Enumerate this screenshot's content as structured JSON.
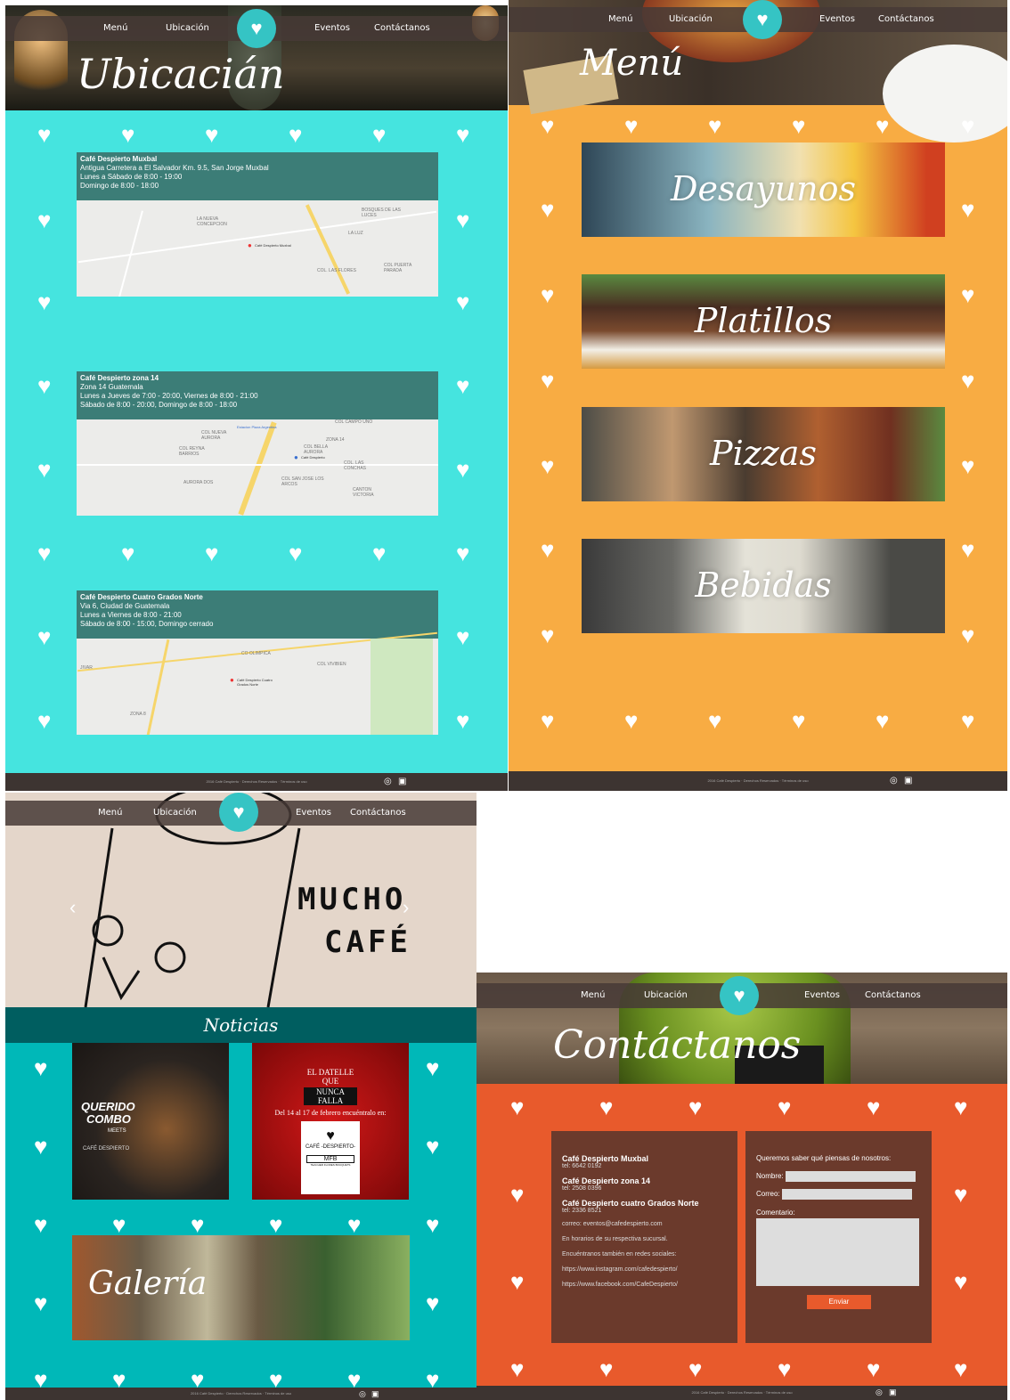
{
  "nav": {
    "menu": "Menú",
    "ubicacion": "Ubicación",
    "eventos": "Eventos",
    "contactanos": "Contáctanos"
  },
  "ubicacion": {
    "title": "Ubicacián",
    "locations": [
      {
        "name": "Café Despierto Muxbal",
        "line1": "Antigua Carretera a El Salvador Km. 9.5, San Jorge Muxbal",
        "line2": "Lunes a Sábado de 8:00 - 19:00",
        "line3": "Domingo de 8:00 - 18:00",
        "pin": "Café Despierto Muxbal",
        "areas": [
          "LA NUEVA CONCEPCION",
          "BOSQUES DE LAS LUCES",
          "LA LUZ",
          "COL. LAS FLORES",
          "COL PUERTA PARADA"
        ]
      },
      {
        "name": "Café Despierto zona 14",
        "line1": "Zona 14 Guatemala",
        "line2": "Lunes a Jueves de 7:00 - 20:00, Viernes de 8:00 - 21:00",
        "line3": "Sábado de 8:00 - 20:00, Domingo de 8:00 - 18:00",
        "pin": "Café Despierto",
        "areas": [
          "COL NUEVA AURORA",
          "COL REYNA BARRIOS",
          "AURORA DOS",
          "ZONA 14",
          "COL BELLA AURORA",
          "COL. LAS CONCHAS",
          "COL SAN JOSE LOS ARCOS",
          "CANTON VICTORIA",
          "COL CAMPO UNO",
          "Estacion Plaza Argentina"
        ]
      },
      {
        "name": "Café Despierto Cuatro Grados Norte",
        "line1": "Via 6, Ciudad de Guatemala",
        "line2": "Lunes a Viernes de 8:00 - 21:00",
        "line3": "Sábado de 8:00 - 15:00, Domingo cerrado",
        "pin": "Café Despierto Cuatro Grados Norte",
        "areas": [
          "CO OLIMPICA",
          "COL VIVIBIEN",
          "ZONA 8",
          "JIVAR"
        ]
      }
    ]
  },
  "menu": {
    "title": "Menú",
    "items": [
      "Desayunos",
      "Platillos",
      "Pizzas",
      "Bebidas"
    ]
  },
  "eventos": {
    "hero_line1": "MUCHO",
    "hero_line2": "CAFÉ",
    "section": "Noticias",
    "gallery": "Galería",
    "news1": {
      "brand1": "QUERIDO",
      "brand2": "COMBO",
      "meets": "MEETS",
      "cafe": "CAFÉ DESPIERTO"
    },
    "news2": {
      "headline1": "EL DATELLE QUE",
      "headline2": "NUNCA FALLA",
      "date": "Del 14 al 17 de febrero encuéntralo en:",
      "cafe": "CAFÉ -DESPIERTO-",
      "mfb": "MFB",
      "mfb2": "TEACHER FLORES BOUQUETS"
    }
  },
  "contacto": {
    "title": "Contáctanos",
    "branches": [
      {
        "name": "Café Despierto Muxbal",
        "tel": "tel: 6642 0192"
      },
      {
        "name": "Café Despierto zona 14",
        "tel": "tel: 2508 0396"
      },
      {
        "name": "Café Despierto cuatro Grados Norte",
        "tel": "tel: 2336 8521"
      }
    ],
    "email": "correo: eventos@cafedespierto.com",
    "hours": "En horarios de su respectiva sucursal.",
    "social": "Encuéntranos también en redes sociales:",
    "instagram": "https://www.instagram.com/cafedespierto/",
    "facebook": "https://www.facebook.com/CafeDespierto/",
    "form_title": "Queremos saber qué piensas de nosotros:",
    "nombre": "Nombre:",
    "correo": "Correo:",
    "comentario": "Comentario:",
    "enviar": "Enviar"
  },
  "footer": "2016 Café Despierto · Derechos Reservados · Términos de uso",
  "colors": {
    "teal": "#45e4df",
    "orange": "#f8ac43",
    "news_teal": "#00b8b8",
    "contact_orange": "#e85a2c",
    "nav": "#463a36"
  }
}
